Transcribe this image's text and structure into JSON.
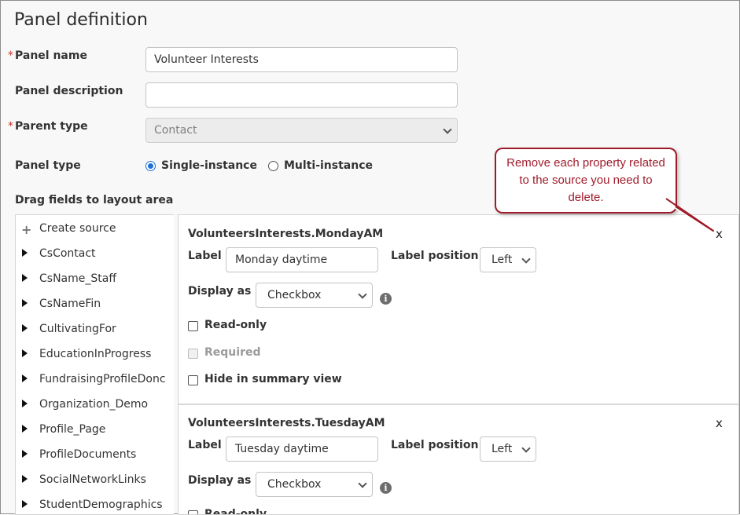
{
  "page": {
    "title": "Panel definition",
    "required_mark": "*"
  },
  "form": {
    "panel_name_label": "Panel name",
    "panel_name_value": "Volunteer Interests",
    "panel_description_label": "Panel description",
    "panel_description_value": "",
    "parent_type_label": "Parent type",
    "parent_type_value": "Contact",
    "panel_type_label": "Panel type",
    "panel_type_options": [
      {
        "label": "Single-instance",
        "selected": true
      },
      {
        "label": "Multi-instance",
        "selected": false
      }
    ]
  },
  "fields": {
    "heading": "Drag fields to layout area",
    "create_source": "Create source",
    "sources": [
      "CsContact",
      "CsName_Staff",
      "CsNameFin",
      "CultivatingFor",
      "EducationInProgress",
      "FundraisingProfileDonc",
      "Organization_Demo",
      "Profile_Page",
      "ProfileDocuments",
      "SocialNetworkLinks",
      "StudentDemographics"
    ]
  },
  "layout": {
    "properties": [
      {
        "name": "VolunteersInterests.MondayAM",
        "label_caption": "Label",
        "label_value": "Monday daytime",
        "label_position_caption": "Label position",
        "label_position_value": "Left",
        "display_as_caption": "Display as",
        "display_as_value": "Checkbox",
        "read_only": "Read-only",
        "required": "Required",
        "hide_summary": "Hide in summary view",
        "remove": "x",
        "info": "i"
      },
      {
        "name": "VolunteersInterests.TuesdayAM",
        "label_caption": "Label",
        "label_value": "Tuesday daytime",
        "label_position_caption": "Label position",
        "label_position_value": "Left",
        "display_as_caption": "Display as",
        "display_as_value": "Checkbox",
        "read_only": "Read-only",
        "remove": "x",
        "info": "i"
      }
    ]
  },
  "callout": {
    "text": "Remove each property related to the source you need to delete.",
    "color": "#9e1c2a"
  }
}
